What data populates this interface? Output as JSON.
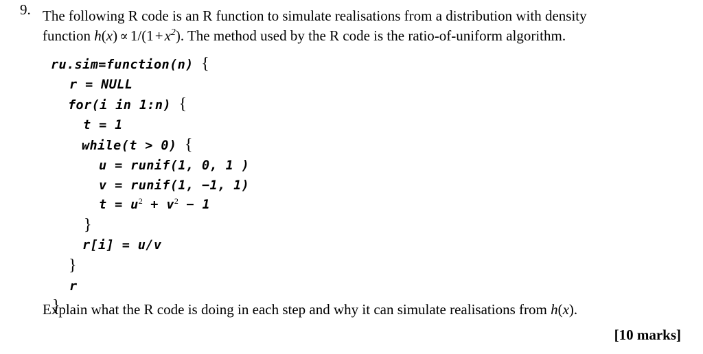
{
  "question": {
    "number": "9.",
    "line1": "The following R code is an R function to simulate realisations from a distribution with density",
    "line2_prefix": "function ",
    "math1": {
      "h": "h",
      "paren_open": "(",
      "x": "x",
      "paren_close": ")",
      "proportional": "∝",
      "one_over": "1/(1",
      "plus": "+",
      "x2_base": "x",
      "x2_exp": "2",
      "close": ").",
      "full": "h(x) ∝ 1/(1 + x²)."
    },
    "line2_suffix": " The method used by the R code is the ratio-of-uniform algorithm."
  },
  "code": {
    "language": "R",
    "lines": [
      {
        "indent": 0,
        "text": "ru.sim=function(n)",
        "brace": "{"
      },
      {
        "indent": 1,
        "text": "r = NULL",
        "brace": ""
      },
      {
        "indent": 1,
        "text": "for(i in 1:n)",
        "brace": "{"
      },
      {
        "indent": 2,
        "text": "t = 1",
        "brace": ""
      },
      {
        "indent": 2,
        "text": "while(t > 0)",
        "brace": "{"
      },
      {
        "indent": 3,
        "text": "u = runif(1, 0, 1 )",
        "brace": ""
      },
      {
        "indent": 3,
        "text": "v = runif(1, −1, 1)",
        "brace": ""
      },
      {
        "indent": 3,
        "text": "t = u² + v² − 1",
        "brace": ""
      },
      {
        "indent": 2,
        "text": "",
        "brace": "}"
      },
      {
        "indent": 2,
        "text": "r[i] = u/v",
        "brace": ""
      },
      {
        "indent": 1,
        "text": "",
        "brace": "}"
      },
      {
        "indent": 1,
        "text": "r",
        "brace": ""
      },
      {
        "indent": 0,
        "text": "",
        "brace": "}"
      }
    ],
    "line_t_expr": {
      "lhs": "t = ",
      "u": "u",
      "u_exp": "2",
      "plus": " + ",
      "v": "v",
      "v_exp": "2",
      "minus": " − 1"
    }
  },
  "explanation": {
    "text_before_math": "Explain what the R code is doing in each step and why it can simulate realisations from ",
    "math": "h(x)",
    "math_h": "h",
    "math_x": "x",
    "text_after_math": "."
  },
  "marks": {
    "label": "[10 marks]"
  }
}
